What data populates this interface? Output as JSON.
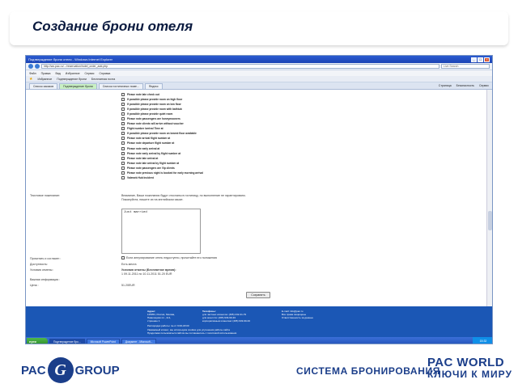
{
  "slide": {
    "title": "Создание брони отеля"
  },
  "browser": {
    "window_title": "Подтверждение брони отеля - Windows Internet Explorer",
    "address": "http://ws.pac.ru/.../reservation/hotel_order_add.php",
    "search_placeholder": "Live Search",
    "menu": [
      "Файл",
      "Правка",
      "Вид",
      "Избранное",
      "Сервис",
      "Справка"
    ],
    "favorites": [
      "Избранное",
      "Подтверждение брони",
      "Бесплатная почта"
    ],
    "tabs": [
      "Список заказов",
      "Подтверждение брони",
      "Список гостиничных номе...",
      "Яндекс"
    ],
    "tools": [
      "Страница",
      "Безопасность",
      "Сервис"
    ]
  },
  "form": {
    "options": [
      "Please note late check out",
      "If possible please provide room on high floor",
      "If possible please provide room on low floor",
      "If possible please provide room with bathtub",
      "If possible please provide quiet room",
      "Please note passengers are honeymooners",
      "Please note clients will arrive without voucher",
      "Flight number /arrival Time at",
      "If possible please provide room on lowest floor available",
      "Please note arrival flight number at",
      "Please note departure flight number at",
      "Please note early arrival at",
      "Please note early arrival by flight number at",
      "Please note late arrival at",
      "Please note late arrival by flight number at",
      "Please note passengers are Vip clients",
      "Please note previous night is booked for early morning arrival",
      "Valeweb Hub Incident"
    ],
    "wishes_label": "Текстовое пожелание:",
    "wishes_note_1": "Внимание, Ваши пожелания будут отосланы в гостиницу, но выполнение не гарантировано.",
    "wishes_note_2": "Пожалуйста, пишите их на английском языке.",
    "textarea_value": "Just married",
    "agree_label": "Прочитать и согласен :",
    "agree_text": "Если аннулирование отель недоступно, прочитайте его положения",
    "availability_label": "Доступность:",
    "availability_value": "Есть места",
    "conditions_label": "Условия отмены :",
    "conditions_title": "Условия отмены (Бесплатное время):",
    "conditions_value": "1 09.11.2011 по 10.11.2011    51.20 EUR",
    "extra_label": "Важная информация :",
    "price_label": "Цена :",
    "price_value": "51.20EUR",
    "save_label": "Сохранить"
  },
  "footer": {
    "address_label": "Адрес:",
    "address_lines": [
      "115054, Россия, Москва,",
      "Павелецкая пл., 2с1,",
      "строение 1"
    ],
    "phones_label": "Телефоны:",
    "phones_lines": [
      "для частных клиентов:  (495) 232-31-79",
      "для агентств:  (495) 933-99-33",
      "корпоративным клиентам:  (495) 933-99-33"
    ],
    "hours_label": "Распорядок работы: пн-пт 9:00-18:00",
    "email_lines": [
      "E-mail: info@pac.ru",
      "Все права защищены",
      "Ответственность за данные"
    ],
    "legal_1": "Уважаемый клиент, мы используем cookies для улучшения работы сайта",
    "legal_2": "Продолжая пользоваться сайтом вы соглашаетесь с политикой использования"
  },
  "taskbar": {
    "start": "пуск",
    "items": [
      "Подтверждение бро...",
      "Microsoft PowerPoint",
      "Документ - Microsoft..."
    ],
    "clock": "15:32"
  },
  "brand": {
    "pac_group": "PAC",
    "group": "GROUP",
    "g_letter": "G",
    "system": "СИСТЕМА БРОНИРОВАНИЯ",
    "pac_world": "PAC WORLD",
    "keys": "КЛЮЧИ К МИРУ"
  }
}
